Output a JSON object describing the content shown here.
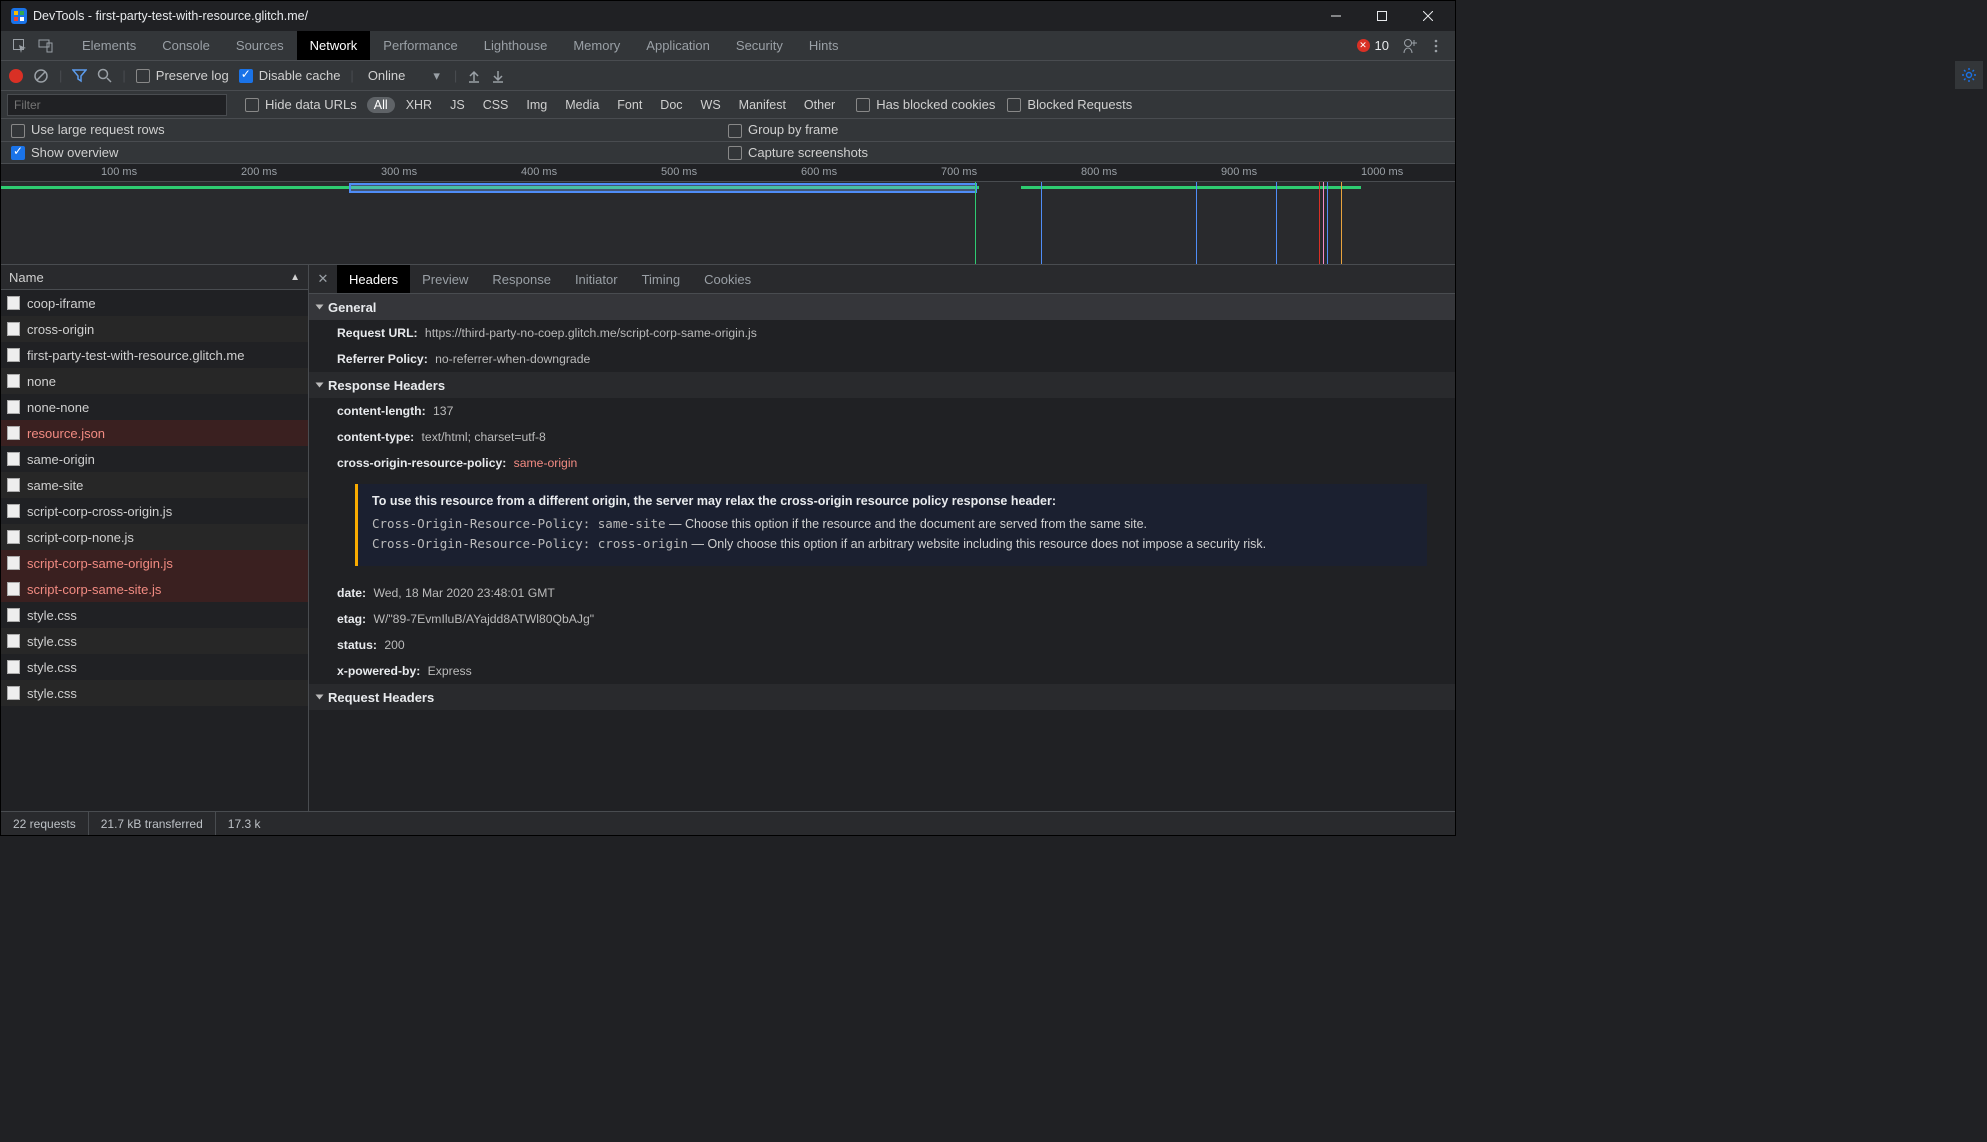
{
  "title": "DevTools - first-party-test-with-resource.glitch.me/",
  "main_tabs": [
    "Elements",
    "Console",
    "Sources",
    "Network",
    "Performance",
    "Lighthouse",
    "Memory",
    "Application",
    "Security",
    "Hints"
  ],
  "active_main_tab": "Network",
  "issues_count": "10",
  "toolbar": {
    "preserve_log": "Preserve log",
    "disable_cache": "Disable cache",
    "throttle": "Online"
  },
  "filter": {
    "placeholder": "Filter",
    "hide_data_urls": "Hide data URLs",
    "types": [
      "All",
      "XHR",
      "JS",
      "CSS",
      "Img",
      "Media",
      "Font",
      "Doc",
      "WS",
      "Manifest",
      "Other"
    ],
    "has_blocked": "Has blocked cookies",
    "blocked_requests": "Blocked Requests"
  },
  "settings": {
    "large_rows": "Use large request rows",
    "group_frame": "Group by frame",
    "show_overview": "Show overview",
    "capture": "Capture screenshots"
  },
  "timeline_ticks": [
    "100 ms",
    "200 ms",
    "300 ms",
    "400 ms",
    "500 ms",
    "600 ms",
    "700 ms",
    "800 ms",
    "900 ms",
    "1000 ms"
  ],
  "name_col": "Name",
  "requests": [
    {
      "name": "coop-iframe",
      "red": false,
      "sel": false
    },
    {
      "name": "cross-origin",
      "red": false,
      "sel": false
    },
    {
      "name": "first-party-test-with-resource.glitch.me",
      "red": false,
      "sel": false
    },
    {
      "name": "none",
      "red": false,
      "sel": false
    },
    {
      "name": "none-none",
      "red": false,
      "sel": false
    },
    {
      "name": "resource.json",
      "red": true,
      "sel": false
    },
    {
      "name": "same-origin",
      "red": false,
      "sel": false
    },
    {
      "name": "same-site",
      "red": false,
      "sel": false
    },
    {
      "name": "script-corp-cross-origin.js",
      "red": false,
      "sel": false
    },
    {
      "name": "script-corp-none.js",
      "red": false,
      "sel": false
    },
    {
      "name": "script-corp-same-origin.js",
      "red": true,
      "sel": true
    },
    {
      "name": "script-corp-same-site.js",
      "red": true,
      "sel": false
    },
    {
      "name": "style.css",
      "red": false,
      "sel": false
    },
    {
      "name": "style.css",
      "red": false,
      "sel": false
    },
    {
      "name": "style.css",
      "red": false,
      "sel": false
    },
    {
      "name": "style.css",
      "red": false,
      "sel": false
    }
  ],
  "sub_tabs": [
    "Headers",
    "Preview",
    "Response",
    "Initiator",
    "Timing",
    "Cookies"
  ],
  "active_sub_tab": "Headers",
  "headers": {
    "general_title": "General",
    "request_url_k": "Request URL:",
    "request_url_v": "https://third-party-no-coep.glitch.me/script-corp-same-origin.js",
    "referrer_k": "Referrer Policy:",
    "referrer_v": "no-referrer-when-downgrade",
    "response_title": "Response Headers",
    "cl_k": "content-length:",
    "cl_v": "137",
    "ct_k": "content-type:",
    "ct_v": "text/html; charset=utf-8",
    "corp_k": "cross-origin-resource-policy:",
    "corp_v": "same-origin",
    "callout_h": "To use this resource from a different origin, the server may relax the cross-origin resource policy response header:",
    "callout_l1_code": "Cross-Origin-Resource-Policy: same-site",
    "callout_l1_txt": " — Choose this option if the resource and the document are served from the same site.",
    "callout_l2_code": "Cross-Origin-Resource-Policy: cross-origin",
    "callout_l2_txt": " — Only choose this option if an arbitrary website including this resource does not impose a security risk.",
    "date_k": "date:",
    "date_v": "Wed, 18 Mar 2020 23:48:01 GMT",
    "etag_k": "etag:",
    "etag_v": "W/\"89-7EvmIluB/AYajdd8ATWl80QbAJg\"",
    "status_k": "status:",
    "status_v": "200",
    "xpb_k": "x-powered-by:",
    "xpb_v": "Express",
    "request_title": "Request Headers"
  },
  "status": {
    "requests": "22 requests",
    "transferred": "21.7 kB transferred",
    "resources": "17.3 k"
  }
}
